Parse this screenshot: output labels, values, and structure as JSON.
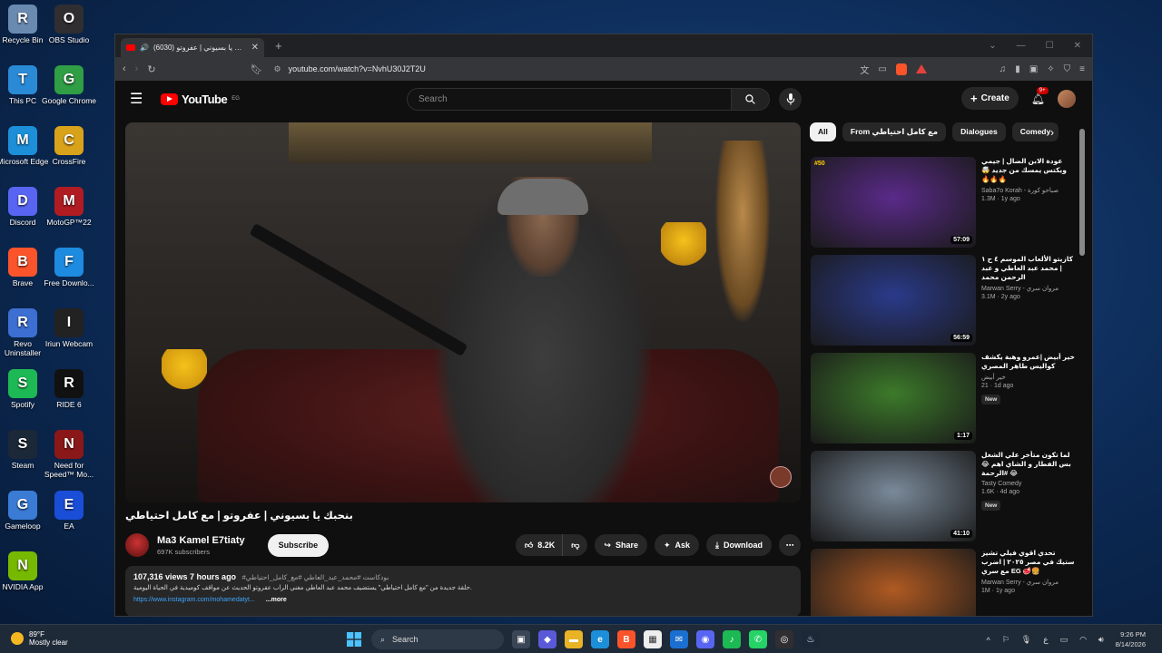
{
  "desktop_icons": [
    {
      "label": "Recycle Bin",
      "icon": "recycle-bin-icon",
      "color": "#6a8ab0"
    },
    {
      "label": "OBS Studio",
      "icon": "obs-icon",
      "color": "#302e31"
    },
    {
      "label": "This PC",
      "icon": "computer-icon",
      "color": "#2a8ad6"
    },
    {
      "label": "Google Chrome",
      "icon": "chrome-icon",
      "color": "#2f9e44"
    },
    {
      "label": "Microsoft Edge",
      "icon": "edge-icon",
      "color": "#1c8fd8"
    },
    {
      "label": "CrossFire",
      "icon": "crossfire-icon",
      "color": "#d9a21b"
    },
    {
      "label": "Discord",
      "icon": "discord-icon",
      "color": "#5865f2"
    },
    {
      "label": "MotoGP™22",
      "icon": "motogp-icon",
      "color": "#b01c22"
    },
    {
      "label": "Brave",
      "icon": "brave-icon",
      "color": "#fb542b"
    },
    {
      "label": "Free Downlo...",
      "icon": "download-icon",
      "color": "#1d8be0"
    },
    {
      "label": "Revo Uninstaller",
      "icon": "revo-icon",
      "color": "#3c6fd1"
    },
    {
      "label": "Iriun Webcam",
      "icon": "webcam-icon",
      "color": "#222"
    },
    {
      "label": "Spotify",
      "icon": "spotify-icon",
      "color": "#1db954"
    },
    {
      "label": "RIDE 6",
      "icon": "ride-icon",
      "color": "#111"
    },
    {
      "label": "Steam",
      "icon": "steam-icon",
      "color": "#1b2838"
    },
    {
      "label": "Need for Speed™ Mo...",
      "icon": "nfs-icon",
      "color": "#8a1818"
    },
    {
      "label": "Gameloop",
      "icon": "gameloop-icon",
      "color": "#3a7bd5"
    },
    {
      "label": "EA",
      "icon": "ea-icon",
      "color": "#1a4ed8"
    },
    {
      "label": "NVIDIA App",
      "icon": "nvidia-icon",
      "color": "#76b900"
    }
  ],
  "browser": {
    "tab_title": "(6030) بنحبك يا بسيوني | عفروتو",
    "url": "youtube.com/watch?v=NvhU30J2T2U"
  },
  "youtube": {
    "logo_text": "YouTube",
    "logo_region": "EG",
    "search_placeholder": "Search",
    "create_label": "Create",
    "notif_count": "9+",
    "video_title": "بنحبك يا بسيوني | عفروتو | مع كامل احتياطي",
    "channel_name": "Ma3 Kamel E7tiaty",
    "channel_subs": "697K subscribers",
    "subscribe_label": "Subscribe",
    "like_count": "8.2K",
    "share_label": "Share",
    "ask_label": "Ask",
    "download_label": "Download",
    "desc_meta": "107,316 views  7 hours ago",
    "desc_tags": "#بودكاست #محمد_عبد_العاطي #مع_كامل_احتياطي",
    "desc_body": "حلقة جديدة من \"مع كامل احتياطي\" يستضيف محمد عبد العاطي مغني الراب عفروتو الحديث عن مواقف كوميدية في الحياة اليومية.",
    "desc_link": "https://www.instagram.com/mohamedatyt...",
    "desc_more": "...more",
    "chips": [
      "All",
      "From مع كامل احتياطي",
      "Dialogues",
      "Comedy"
    ],
    "recommendations": [
      {
        "title": "عودة الابن الضال | جيمي ويكتس يمسك من جديد 🤯 🔥🔥🔥",
        "channel": "Saba7o Korah - صباحو كورة",
        "stats": "1.3M · 1y ago",
        "duration": "57:09",
        "badge": "",
        "tag": "#50",
        "bg": "#5a2a8a"
      },
      {
        "title": "كازيتو الألعاب الموسم ٤ ح ١ | محمد عبد العاطي و عبد الرحمن محمد",
        "channel": "Marwan Serry - مروان سري",
        "stats": "3.1M · 2y ago",
        "duration": "56:59",
        "badge": "",
        "tag": "",
        "bg": "#2a3a8a"
      },
      {
        "title": "خير أبيض |عمرو وهبة يكشف كواليس طاهر المصري",
        "channel": "خير أبيض",
        "stats": "21 · 1d ago",
        "duration": "1:17",
        "badge": "New",
        "tag": "",
        "bg": "#3c7a2a"
      },
      {
        "title": "لما تكون متأخر علي الشغل بس الفطار و الشاي اهم 😂😂 #الرحمة",
        "channel": "Tasty Comedy",
        "stats": "1.6K · 4d ago",
        "duration": "41:10",
        "badge": "New",
        "tag": "",
        "bg": "#7a8a9a"
      },
      {
        "title": "تحدي اقوي فيلي تشيز ستيك في مصر ٢٠٢٥ | اضرب 🍔🥩 EG مع سري",
        "channel": "Marwan Serry - مروان سري",
        "stats": "1M · 1y ago",
        "duration": "",
        "badge": "",
        "tag": "",
        "bg": "#b05a22"
      }
    ]
  },
  "taskbar": {
    "weather_temp": "89°F",
    "weather_desc": "Mostly clear",
    "search_label": "Search",
    "time": "9:26 PM",
    "date": "8/14/2026"
  }
}
